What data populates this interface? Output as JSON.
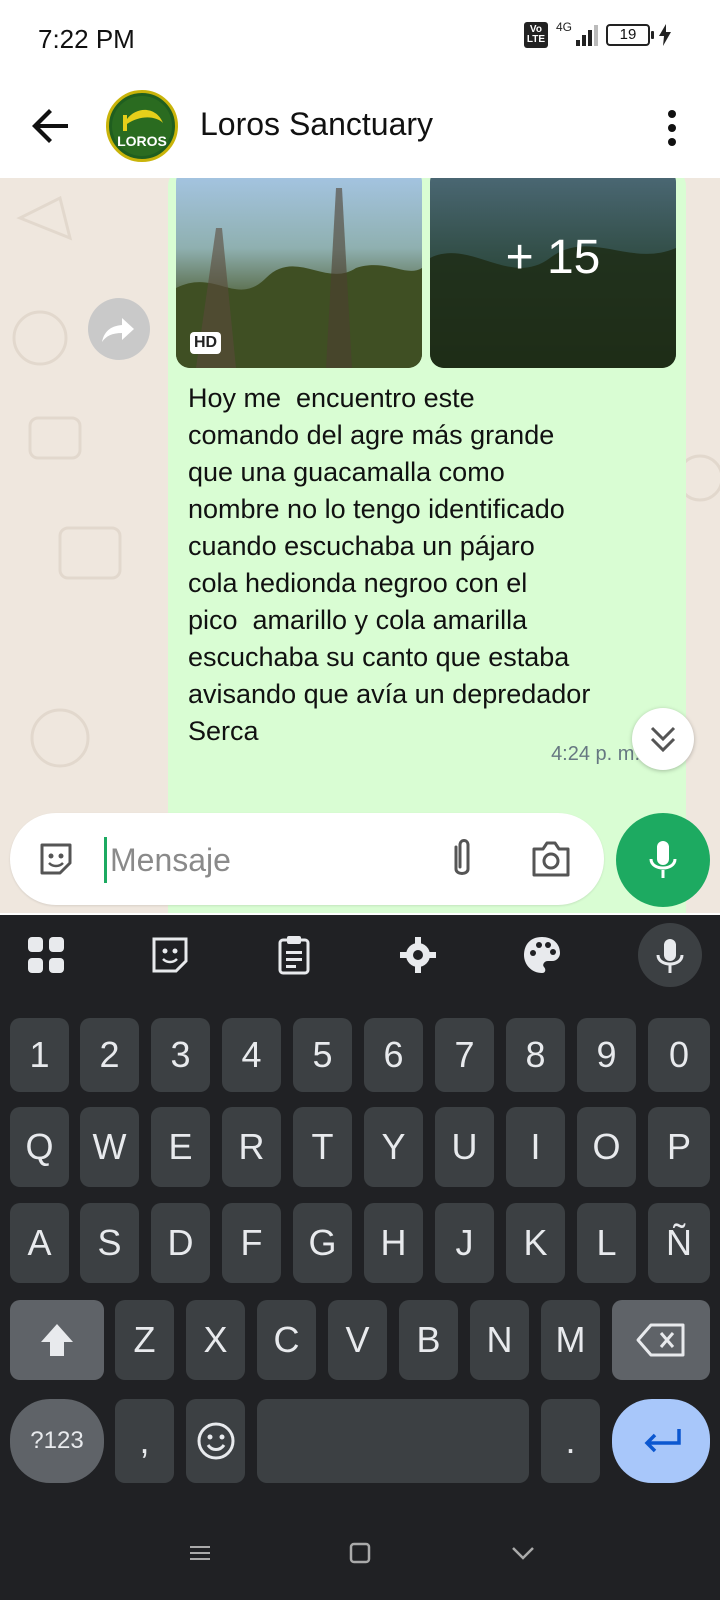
{
  "status_bar": {
    "time": "7:22 PM",
    "volte_top": "Vo",
    "volte_bottom": "LTE",
    "network": "4G",
    "battery": "19"
  },
  "header": {
    "title": "Loros Sanctuary",
    "avatar_text": "LOROS"
  },
  "message": {
    "extra_photos": "+ 15",
    "hd_label": "HD",
    "text": "Hoy me  encuentro este\ncomando del agre más grande\nque una guacamalla como\nnombre no lo tengo identificado\ncuando escuchaba un pájaro\ncola hedionda negroo con el\npico  amarillo y cola amarilla\nescuchaba su canto que estaba\navisando que avía un depredador\nSerca",
    "time": "4:24 p. m."
  },
  "composer": {
    "placeholder": "Mensaje"
  },
  "keyboard": {
    "row_numbers": [
      "1",
      "2",
      "3",
      "4",
      "5",
      "6",
      "7",
      "8",
      "9",
      "0"
    ],
    "row_1": [
      "Q",
      "W",
      "E",
      "R",
      "T",
      "Y",
      "U",
      "I",
      "O",
      "P"
    ],
    "row_2": [
      "A",
      "S",
      "D",
      "F",
      "G",
      "H",
      "J",
      "K",
      "L",
      "Ñ"
    ],
    "row_3": [
      "Z",
      "X",
      "C",
      "V",
      "B",
      "N",
      "M"
    ],
    "symbols_label": "?123",
    "comma": ",",
    "period": "."
  },
  "colors": {
    "bubble": "#d9fdd3",
    "accent": "#1daa61",
    "chat_bg": "#efe7de",
    "keyboard_bg": "#202124"
  }
}
